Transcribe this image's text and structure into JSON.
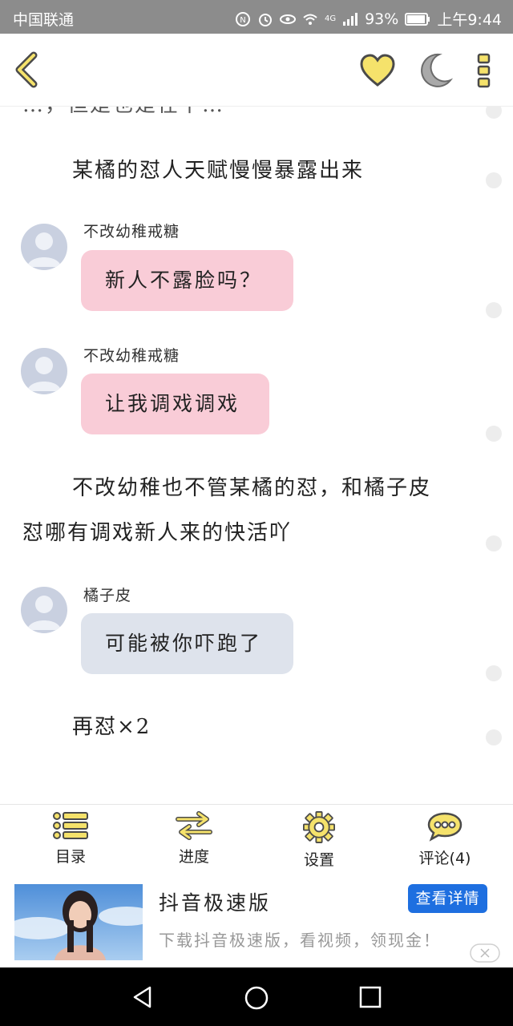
{
  "status_bar": {
    "carrier": "中国联通",
    "battery": "93%",
    "time": "上午9:44",
    "network": "4G"
  },
  "top_bar": {
    "icons": [
      "back-chevron-icon",
      "heart-icon",
      "moon-icon",
      "more-vertical-icon"
    ],
    "accent_color": "#f5e26b"
  },
  "content": {
    "partial_top_line": "…，但是也是在下…",
    "paragraph1": "某橘的怼人天赋慢慢暴露出来",
    "messages": [
      {
        "user": "不改幼稚戒糖",
        "text": "新人不露脸吗？",
        "bubble_color": "#f9ccd7"
      },
      {
        "user": "不改幼稚戒糖",
        "text": "让我调戏调戏",
        "bubble_color": "#f9ccd7"
      },
      {
        "user": "橘子皮",
        "text": "可能被你吓跑了",
        "bubble_color": "#dee3ec"
      }
    ],
    "paragraph2_line1": "不改幼稚也不管某橘的怼，和橘子皮",
    "paragraph2_line2": "怼哪有调戏新人来的快活吖",
    "paragraph3": "再怼×2"
  },
  "bottom_nav": {
    "items": [
      {
        "label": "目录",
        "icon": "list-icon"
      },
      {
        "label": "进度",
        "icon": "swap-arrows-icon"
      },
      {
        "label": "设置",
        "icon": "gear-icon"
      },
      {
        "label": "评论(4)",
        "icon": "comment-icon"
      }
    ]
  },
  "ad": {
    "title": "抖音极速版",
    "subtitle": "下载抖音极速版，看视频，领现金！",
    "button": "查看详情",
    "button_color": "#1e6fe0"
  },
  "system_nav": {
    "icons": [
      "back-triangle-icon",
      "home-circle-icon",
      "recents-square-icon"
    ]
  }
}
